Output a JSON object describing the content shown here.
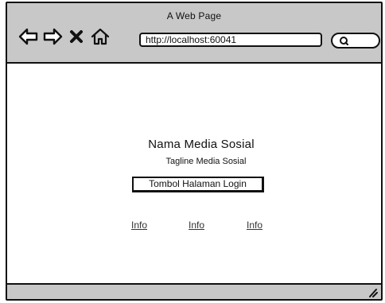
{
  "window": {
    "title": "A Web Page"
  },
  "toolbar": {
    "buttons": [
      {
        "name": "back-button",
        "icon": "arrow-left-icon"
      },
      {
        "name": "forward-button",
        "icon": "arrow-right-icon"
      },
      {
        "name": "stop-button",
        "icon": "close-icon"
      },
      {
        "name": "home-button",
        "icon": "home-icon"
      }
    ],
    "url": "http://localhost:60041",
    "search_icon": "search-icon"
  },
  "page": {
    "app_name": "Nama Media Sosial",
    "tagline": "Tagline Media Sosial",
    "login_button_label": "Tombol Halaman Login",
    "info_links": [
      "Info",
      "Info",
      "Info"
    ]
  },
  "statusbar": {
    "grip_icon": "resize-grip-icon"
  },
  "colors": {
    "chrome": "#c8c8c8",
    "outline": "#111111",
    "content_bg": "#ffffff"
  }
}
